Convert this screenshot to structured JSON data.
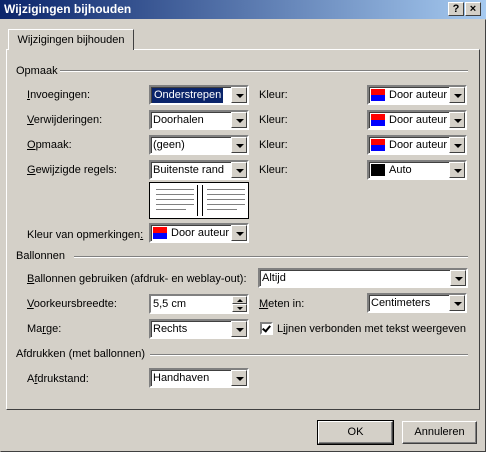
{
  "window": {
    "title": "Wijzigingen bijhouden",
    "help_label": "?",
    "close_label": "×"
  },
  "tab": {
    "label": "Wijzigingen bijhouden"
  },
  "markup": {
    "group_label": "Opmaak",
    "insertions": {
      "label_u": "I",
      "label_rest": "nvoegingen:",
      "value": "Onderstrepen",
      "color_label": "Kleur:",
      "color_value": "Door auteur"
    },
    "deletions": {
      "label_u": "V",
      "label_rest": "erwijderingen:",
      "value": "Doorhalen",
      "color_label": "Kleur:",
      "color_value": "Door auteur"
    },
    "formatting": {
      "label_u": "O",
      "label_rest": "pmaak:",
      "value": "(geen)",
      "color_label": "Kleur:",
      "color_value": "Door auteur"
    },
    "changed_lines": {
      "label_u": "G",
      "label_rest": "ewijzigde regels:",
      "value": "Buitenste rand",
      "color_label": "Kleur:",
      "color_value": "Auto"
    },
    "comments_color": {
      "label_pre": "Kleur van opmerkingen",
      "label_u": ":",
      "value": "Door auteur"
    }
  },
  "balloons": {
    "group_label": "Ballonnen",
    "use": {
      "label_u": "B",
      "label_rest": "allonnen gebruiken (afdruk- en weblay-out):",
      "value": "Altijd"
    },
    "width": {
      "label_u": "V",
      "label_rest": "oorkeursbreedte:",
      "value": "5,5 cm"
    },
    "measure": {
      "label_pre": "M",
      "label_rest": "eten in:",
      "value": "Centimeters"
    },
    "margin": {
      "label_pre": "Ma",
      "label_u": "r",
      "label_rest": "ge:",
      "value": "Rechts"
    },
    "lines": {
      "label_pre": "L",
      "label_u": "i",
      "label_rest": "jnen verbonden met tekst weergeven",
      "checked": true
    }
  },
  "print": {
    "group_label": "Afdrukken (met ballonnen)",
    "orientation": {
      "label_pre": "A",
      "label_u": "f",
      "label_rest": "drukstand:",
      "value": "Handhaven"
    }
  },
  "buttons": {
    "ok": "OK",
    "cancel": "Annuleren"
  },
  "colors": {
    "title_start": "#0a246a",
    "title_end": "#a6caf0",
    "face": "#d4d0c8",
    "swatch_red": "#ff0000",
    "swatch_blue": "#0000ff"
  }
}
